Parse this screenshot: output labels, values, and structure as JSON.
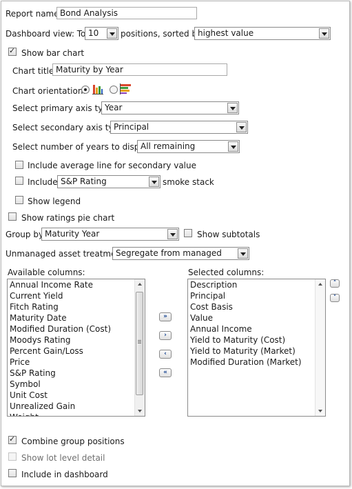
{
  "report_name": {
    "label": "Report name:",
    "value": "Bond Analysis"
  },
  "dashboard_view": {
    "label_prefix": "Dashboard view: Top",
    "top_value": "10",
    "label_mid": "positions, sorted by",
    "sort_value": "highest value"
  },
  "show_bar_chart": {
    "label": "Show bar chart",
    "checked": true
  },
  "chart_title": {
    "label": "Chart title:",
    "value": "Maturity by Year"
  },
  "chart_orientation": {
    "label": "Chart orientation:",
    "selected": "vertical"
  },
  "primary_axis": {
    "label": "Select primary axis type:",
    "value": "Year"
  },
  "secondary_axis": {
    "label": "Select secondary axis type:",
    "value": "Principal"
  },
  "years_display": {
    "label": "Select number of years to display:",
    "value": "All remaining"
  },
  "average_line": {
    "label": "Include average line for secondary value",
    "checked": false
  },
  "include_rating": {
    "label": "Include",
    "value": "S&P Rating",
    "suffix": "smoke stack",
    "checked": false
  },
  "show_legend": {
    "label": "Show legend",
    "checked": false
  },
  "show_pie": {
    "label": "Show ratings pie chart",
    "checked": false
  },
  "group_by": {
    "label": "Group by",
    "value": "Maturity Year"
  },
  "show_subtotals": {
    "label": "Show subtotals",
    "checked": false
  },
  "unmanaged": {
    "label": "Unmanaged asset treatment:",
    "value": "Segregate from managed"
  },
  "available": {
    "label": "Available columns:",
    "items": [
      "Annual Income Rate",
      "Current Yield",
      "Fitch Rating",
      "Maturity Date",
      "Modified Duration (Cost)",
      "Moodys Rating",
      "Percent Gain/Loss",
      "Price",
      "S&P Rating",
      "Symbol",
      "Unit Cost",
      "Unrealized Gain",
      "Weight"
    ]
  },
  "selected": {
    "label": "Selected columns:",
    "items": [
      "Description",
      "Principal",
      "Cost Basis",
      "Value",
      "Annual Income",
      "Yield to Maturity (Cost)",
      "Yield to Maturity (Market)",
      "Modified Duration (Market)"
    ]
  },
  "move_buttons": {
    "add_all": "»",
    "add": "›",
    "remove": "‹",
    "remove_all": "«"
  },
  "order_buttons": {
    "up": "˄",
    "down": "˅"
  },
  "combine": {
    "label": "Combine group positions",
    "checked": true
  },
  "lot_detail": {
    "label": "Show lot level detail",
    "checked": false,
    "disabled": true
  },
  "in_dashboard": {
    "label": "Include in dashboard",
    "checked": false
  },
  "colors": {
    "accent": "#0b3b8c",
    "border": "#8a8a8a"
  }
}
